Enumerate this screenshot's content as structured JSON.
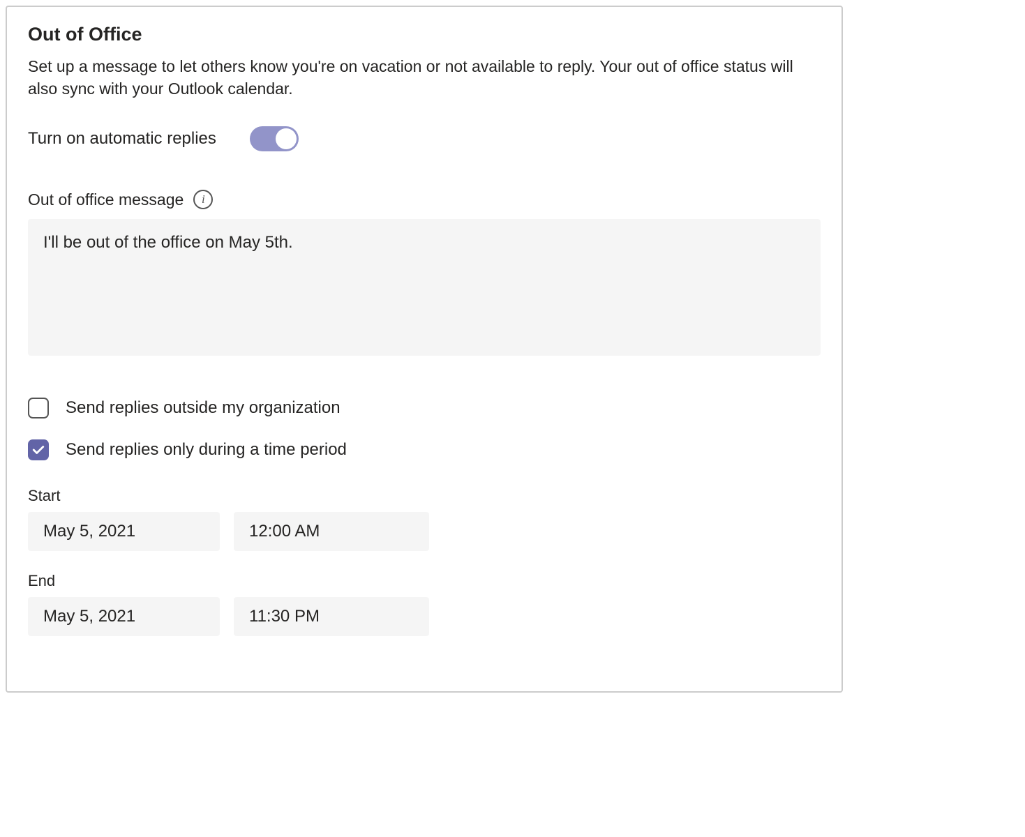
{
  "dialog": {
    "title": "Out of Office",
    "description": "Set up a message to let others know you're on vacation or not available to reply. Your out of office status will also sync with your Outlook calendar."
  },
  "toggle": {
    "label": "Turn on automatic replies",
    "enabled": true
  },
  "message": {
    "label": "Out of office message",
    "value": "I'll be out of the office on May 5th."
  },
  "checkboxes": {
    "outside_org": {
      "label": "Send replies outside my organization",
      "checked": false
    },
    "time_period": {
      "label": "Send replies only during a time period",
      "checked": true
    }
  },
  "period": {
    "start": {
      "label": "Start",
      "date": "May 5, 2021",
      "time": "12:00 AM"
    },
    "end": {
      "label": "End",
      "date": "May 5, 2021",
      "time": "11:30 PM"
    }
  }
}
